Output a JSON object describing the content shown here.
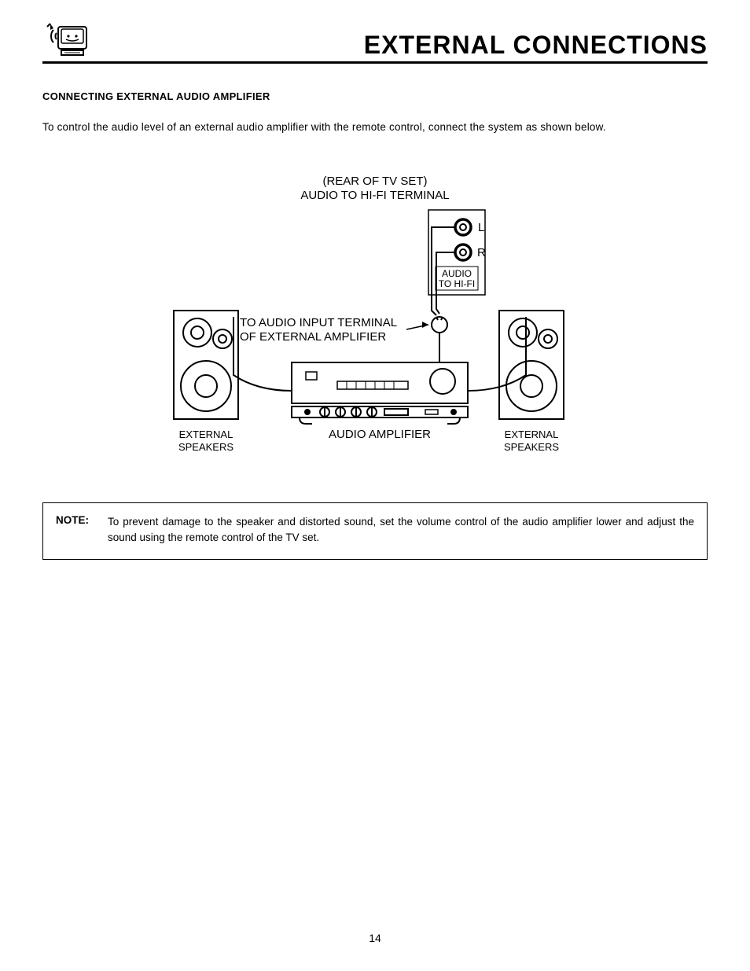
{
  "header": {
    "title": "EXTERNAL CONNECTIONS"
  },
  "section": {
    "heading": "CONNECTING EXTERNAL AUDIO AMPLIFIER",
    "intro": "To control the audio level of an external audio amplifier with the remote control, connect the system as shown below."
  },
  "diagram": {
    "rear_line1": "(REAR OF TV SET)",
    "rear_line2": "AUDIO TO HI-FI TERMINAL",
    "jack_L": "L",
    "jack_R": "R",
    "jack_box_line1": "AUDIO",
    "jack_box_line2": "TO HI-FI",
    "input_line1": "TO AUDIO INPUT TERMINAL",
    "input_line2": "OF EXTERNAL AMPLIFIER",
    "amp_label": "AUDIO AMPLIFIER",
    "left_spk_line1": "EXTERNAL",
    "left_spk_line2": "SPEAKERS",
    "right_spk_line1": "EXTERNAL",
    "right_spk_line2": "SPEAKERS"
  },
  "note": {
    "label": "NOTE:",
    "text": "To prevent damage to the speaker and distorted sound, set the volume control of the audio amplifier lower and adjust the sound using the remote control of the TV set."
  },
  "page_number": "14"
}
